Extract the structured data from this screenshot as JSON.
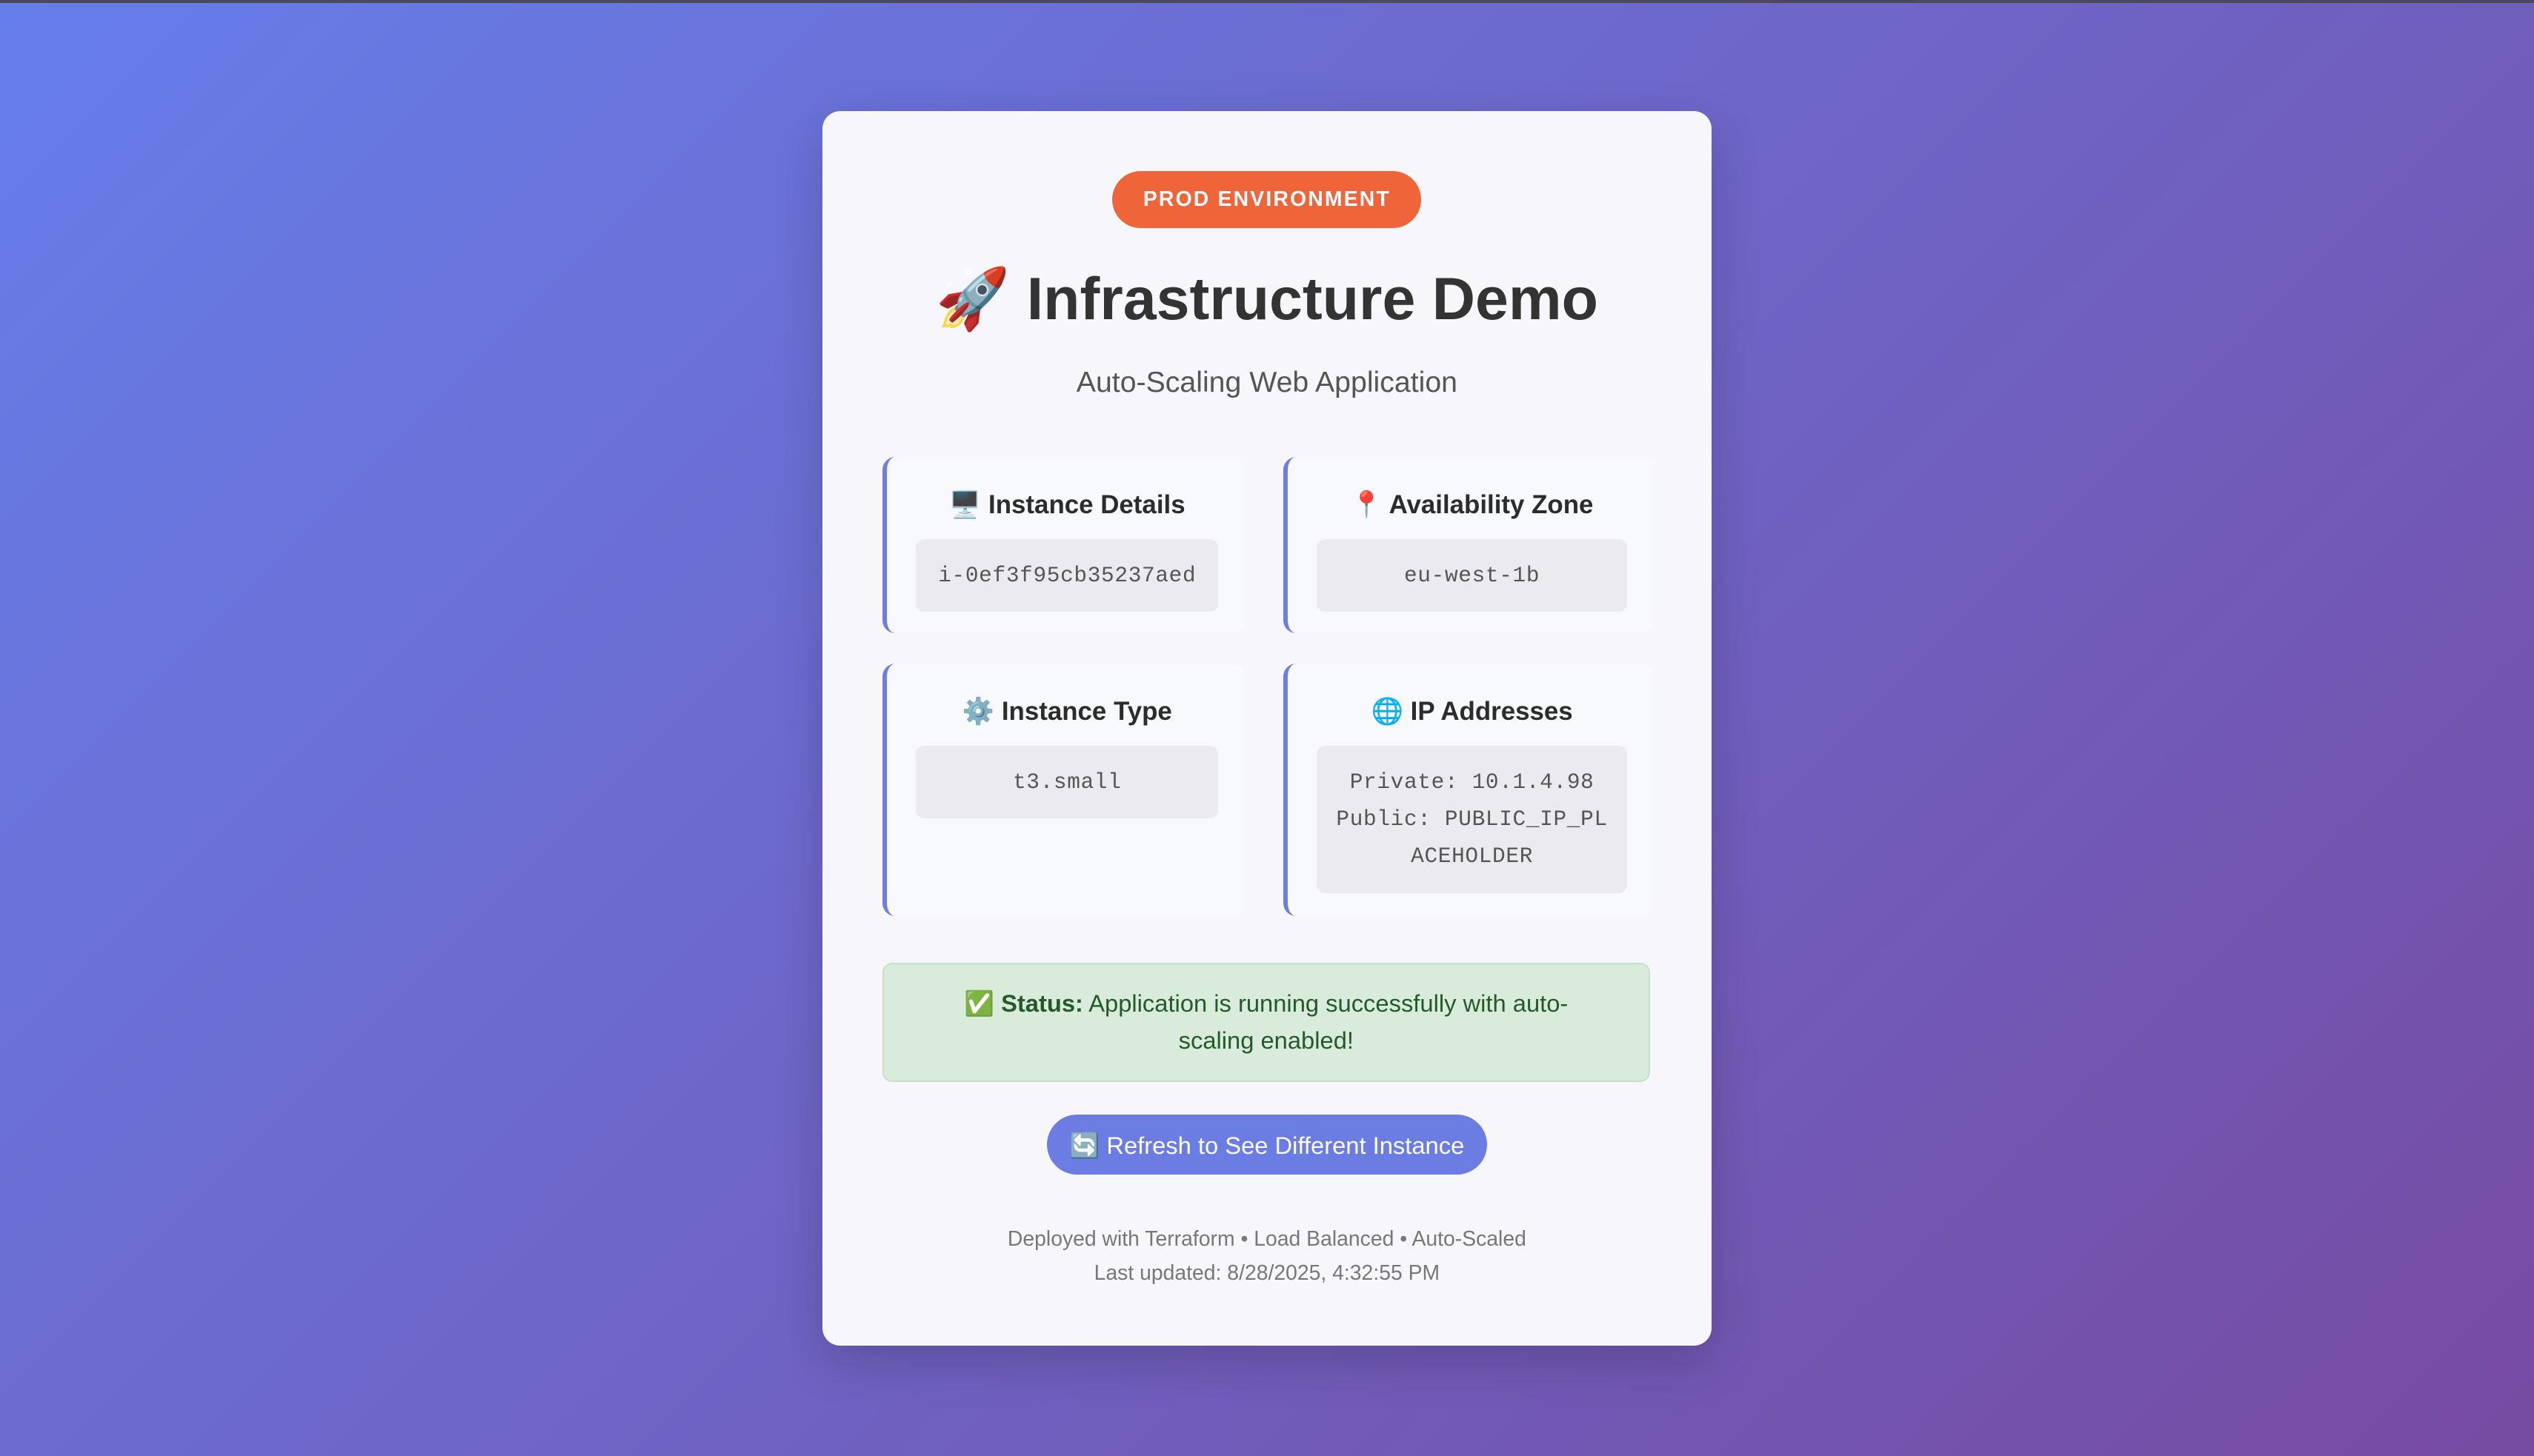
{
  "badge": "PROD ENVIRONMENT",
  "title_icon": "🚀",
  "title": "Infrastructure Demo",
  "subtitle": "Auto-Scaling Web Application",
  "cards": [
    {
      "icon": "🖥️",
      "title": "Instance Details",
      "value": "i-0ef3f95cb35237aed"
    },
    {
      "icon": "📍",
      "title": "Availability Zone",
      "value": "eu-west-1b"
    },
    {
      "icon": "⚙️",
      "title": "Instance Type",
      "value": "t3.small"
    },
    {
      "icon": "🌐",
      "title": "IP Addresses",
      "private": "Private: 10.1.4.98",
      "public": "Public: PUBLIC_IP_PLACEHOLDER"
    }
  ],
  "status": {
    "icon": "✅",
    "label": "Status:",
    "text": "Application is running successfully with auto-scaling enabled!"
  },
  "refresh_button": {
    "icon": "🔄",
    "label": "Refresh to See Different Instance"
  },
  "footer": {
    "line1": "Deployed with Terraform • Load Balanced • Auto-Scaled",
    "line2": "Last updated: 8/28/2025, 4:32:55 PM"
  },
  "colors": {
    "accent": "#6b7de2",
    "badge": "#f0643a",
    "status_bg": "#d9ecdb",
    "bg_start": "#667eea",
    "bg_end": "#764ba2"
  }
}
